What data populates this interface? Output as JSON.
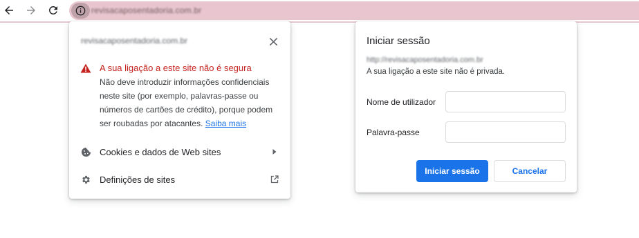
{
  "browser": {
    "url_blurred": "revisacaposentadoria.com.br",
    "icons": {
      "back": "back-arrow-icon",
      "forward": "forward-arrow-icon",
      "reload": "reload-icon",
      "site_info": "info-icon"
    },
    "omnibox_color": "#e9c6cf"
  },
  "site_info_popup": {
    "site_url_blurred": "revisacaposentadoria.com.br",
    "warning_title": "A sua ligação a este site não é segura",
    "warning_body": "Não deve introduzir informações confidenciais neste site (por exemplo, palavras-passe ou números de cartões de crédito), porque podem ser roubadas por atacantes.",
    "learn_more": "Saiba mais",
    "menu": [
      {
        "label": "Cookies e dados de Web sites",
        "icon": "cookie-icon",
        "trail_icon": "chevron-right-icon"
      },
      {
        "label": "Definições de sites",
        "icon": "gear-icon",
        "trail_icon": "external-link-icon"
      }
    ],
    "warning_color": "#c5221f"
  },
  "login_dialog": {
    "title": "Iniciar sessão",
    "origin_blurred": "http://revisacaposentadoria.com.br",
    "note": "A sua ligação a este site não é privada.",
    "username_label": "Nome de utilizador",
    "username_value": "",
    "password_label": "Palavra-passe",
    "password_value": "",
    "submit_label": "Iniciar sessão",
    "cancel_label": "Cancelar",
    "accent_color": "#1a73e8"
  }
}
